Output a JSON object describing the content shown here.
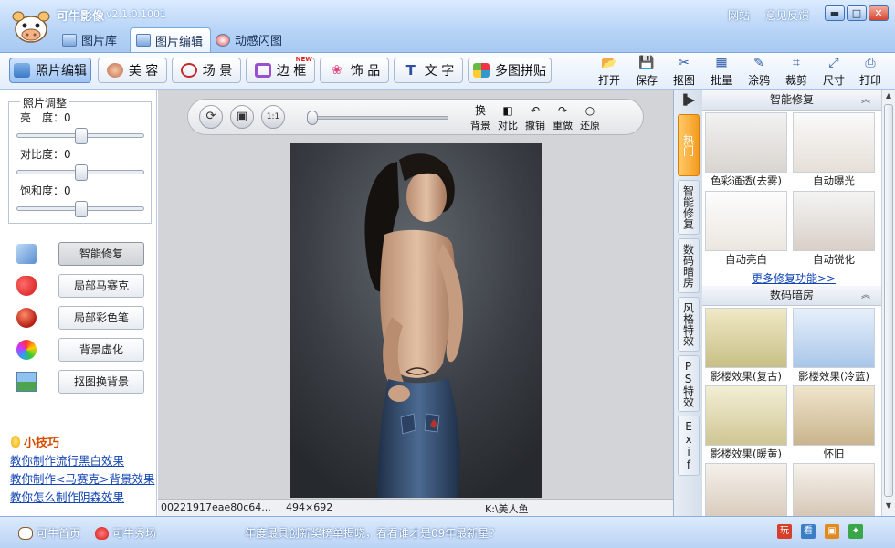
{
  "window": {
    "app_name": "可牛影像",
    "version": "v2.1.0.1001",
    "links": [
      "网站",
      "意见反馈"
    ],
    "controls": {
      "minimize": "▬",
      "maximize": "□",
      "close": "✕"
    }
  },
  "main_tabs": [
    {
      "label": "图片库",
      "icon": "photo-library-icon"
    },
    {
      "label": "图片编辑",
      "icon": "photo-edit-icon",
      "active": true
    },
    {
      "label": "动感闪图",
      "icon": "animation-icon"
    }
  ],
  "toolbar": {
    "tools": [
      "照片编辑",
      "美 容",
      "场 景",
      "边 框",
      "饰 品",
      "文 字",
      "多图拼贴"
    ],
    "new_badge": "NEW",
    "actions": [
      "打开",
      "保存",
      "抠图",
      "批量",
      "涂鸦",
      "裁剪",
      "尺寸",
      "打印"
    ]
  },
  "adjust": {
    "legend": "照片调整",
    "items": [
      {
        "label": "亮　度：",
        "value": "0"
      },
      {
        "label": "对比度：",
        "value": "0"
      },
      {
        "label": "饱和度：",
        "value": "0"
      }
    ]
  },
  "features": [
    "智能修复",
    "局部马赛克",
    "局部彩色笔",
    "背景虚化",
    "抠图换背景"
  ],
  "tips": {
    "title": "小技巧",
    "links": [
      "教你制作流行黑白效果",
      "教你制作<马赛克>背景效果",
      "教你怎么制作阴森效果"
    ]
  },
  "canvas_toolbar": {
    "round_buttons": [
      "⟳",
      "▣",
      "1:1"
    ],
    "tools": [
      {
        "icon": "换",
        "label": "背景"
      },
      {
        "icon": "◧",
        "label": "对比"
      },
      {
        "icon": "↶",
        "label": "撤销"
      },
      {
        "icon": "↷",
        "label": "重做"
      },
      {
        "icon": "○",
        "label": "还原"
      }
    ]
  },
  "status": {
    "filename": "00221917eae80c64...",
    "dimensions": "494×692",
    "path": "K:\\美人鱼"
  },
  "side_tabs": [
    "热门",
    "智能修复",
    "数码暗房",
    "风格特效",
    "PS特效",
    "Exif"
  ],
  "smart_repair": {
    "header": "智能修复",
    "items": [
      "色彩通透(去雾)",
      "自动曝光",
      "自动亮白",
      "自动锐化"
    ],
    "more_link": "更多修复功能>>"
  },
  "darkroom": {
    "header": "数码暗房",
    "items": [
      "影楼效果(复古)",
      "影楼效果(冷蓝)",
      "影楼效果(暖黄)",
      "怀旧"
    ]
  },
  "bottom": {
    "home": "可牛首页",
    "show": "可牛秀场",
    "news": "年度最具创新奖榜单揭晓，看看谁才是09年最新星？"
  }
}
